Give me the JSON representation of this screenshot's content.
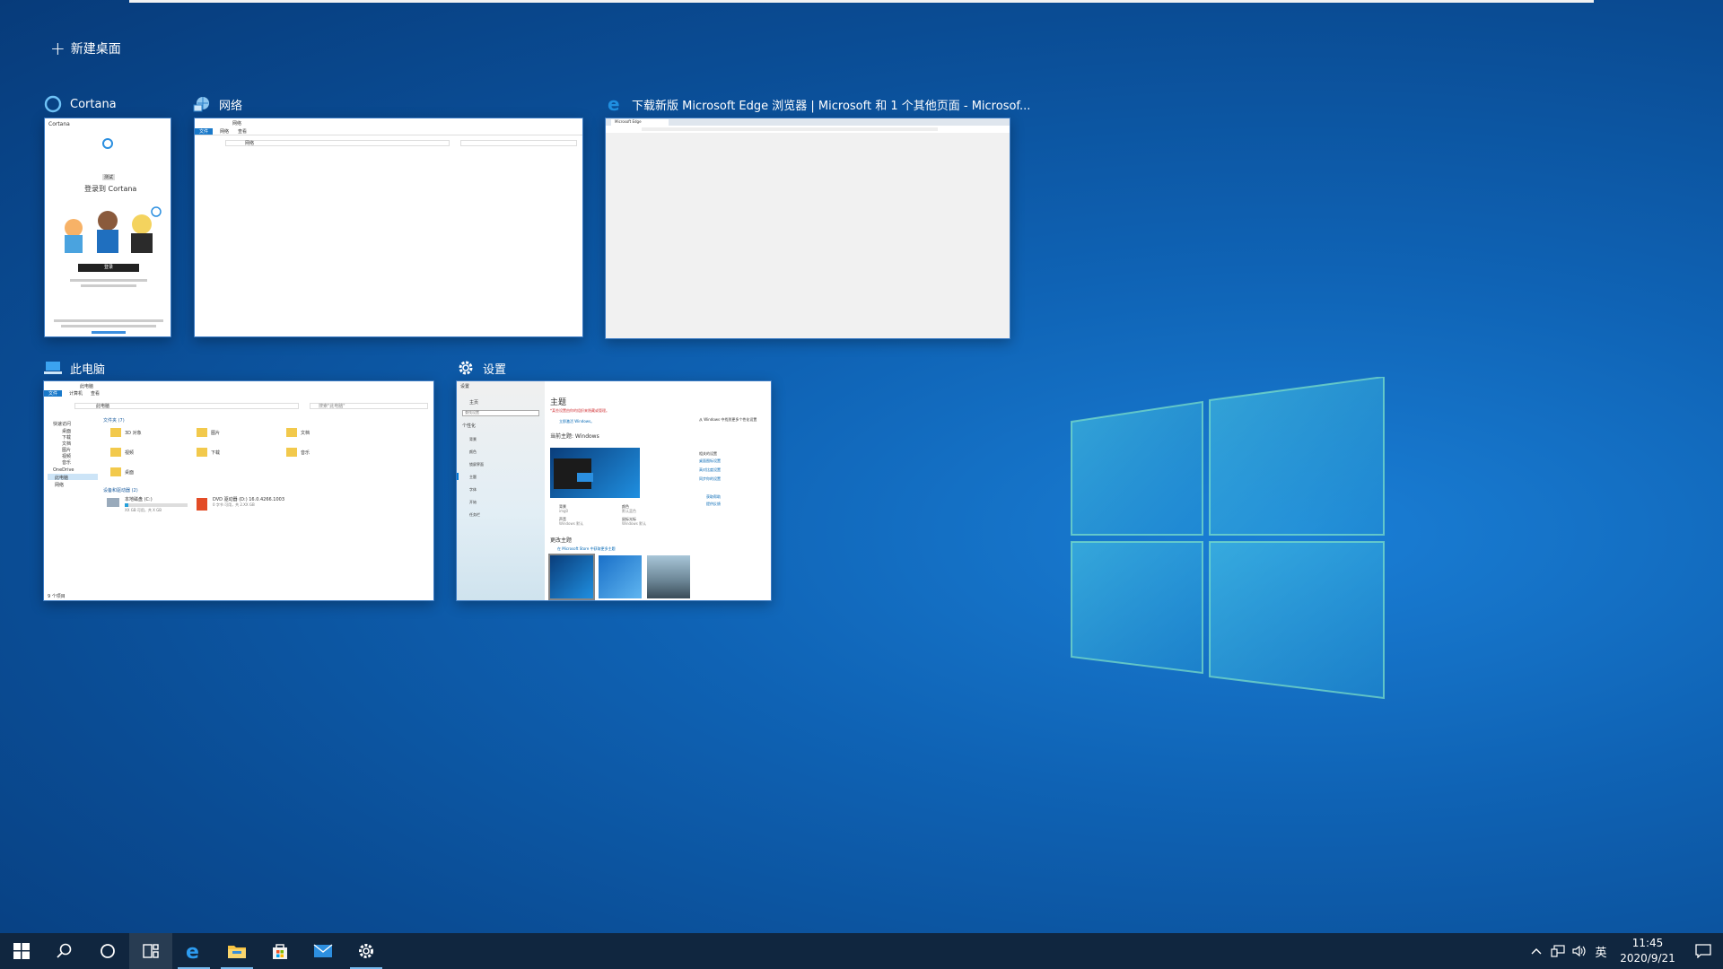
{
  "new_desktop_label": "新建桌面",
  "windows": [
    {
      "title": "Cortana",
      "icon": "cortana-ring-icon",
      "content": {
        "app_name": "Cortana",
        "badge": "测试",
        "signin_title": "登录到 Cortana",
        "signin_button": "登录"
      }
    },
    {
      "title": "网络",
      "icon": "network-icon",
      "content": {
        "window_title": "网络",
        "tabs": [
          "文件",
          "网络",
          "查看"
        ],
        "address": "网络"
      }
    },
    {
      "title": "下载新版 Microsoft Edge 浏览器 | Microsoft 和 1 个其他页面 - Microsof...",
      "icon": "edge-icon",
      "content": {
        "tab_title": "Microsoft Edge"
      }
    },
    {
      "title": "此电脑",
      "icon": "this-pc-icon",
      "content": {
        "window_title": "此电脑",
        "tabs": [
          "文件",
          "计算机",
          "查看"
        ],
        "address": "此电脑",
        "search_placeholder": "搜索\"此电脑\"",
        "nav": [
          "快速访问",
          "桌面",
          "下载",
          "文档",
          "图片",
          "视频",
          "音乐",
          "OneDrive",
          "此电脑",
          "网络"
        ],
        "folders_header": "文件夹 (7)",
        "folders": [
          "3D 对象",
          "视频",
          "图片",
          "文档",
          "下载",
          "音乐",
          "桌面"
        ],
        "devices_header": "设备和驱动器 (2)",
        "drives": [
          {
            "name": "本地磁盘 (C:)",
            "detail": "XX GB 可用，共 X GB"
          },
          {
            "name": "DVD 驱动器 (D:) 16.0.4266.1003",
            "detail": "0 字节 可用，共 2.XX GB"
          }
        ],
        "status": "9 个项目"
      }
    },
    {
      "title": "设置",
      "icon": "gear-icon",
      "content": {
        "app_name": "设置",
        "home": "主页",
        "search_placeholder": "查找设置",
        "section": "个性化",
        "nav": [
          "背景",
          "颜色",
          "锁屏界面",
          "主题",
          "字体",
          "开始",
          "任务栏"
        ],
        "page_title": "主题",
        "warning": "*某些设置由你的组织来隐藏或管理。",
        "sync_link": "立即激活 Windows。",
        "current_theme": "当前主题: Windows",
        "options": [
          {
            "label": "背景",
            "value": "img0"
          },
          {
            "label": "颜色",
            "value": "默认蓝色"
          },
          {
            "label": "声音",
            "value": "Windows 默认"
          },
          {
            "label": "鼠标光标",
            "value": "Windows 默认"
          }
        ],
        "side_note": "从 Windows 中找到更多个性化设置",
        "related_title": "相关的设置",
        "related_links": [
          "桌面图标设置",
          "高对比度设置",
          "同步你的设置"
        ],
        "help_links": [
          "获取帮助",
          "提供反馈"
        ],
        "change_theme": "更改主题",
        "store_link": "在 Microsoft Store 中获取更多主题"
      }
    }
  ],
  "taskbar": {
    "buttons": [
      {
        "name": "start-button",
        "icon": "windows-logo-icon"
      },
      {
        "name": "search-button",
        "icon": "search-icon"
      },
      {
        "name": "cortana-button",
        "icon": "cortana-ring-icon"
      },
      {
        "name": "task-view-button",
        "icon": "task-view-icon",
        "active": true
      },
      {
        "name": "edge-button",
        "icon": "edge-icon",
        "running": true
      },
      {
        "name": "file-explorer-button",
        "icon": "folder-icon",
        "running": true
      },
      {
        "name": "store-button",
        "icon": "store-icon"
      },
      {
        "name": "mail-button",
        "icon": "mail-icon"
      },
      {
        "name": "settings-button",
        "icon": "gear-icon",
        "running": true
      }
    ],
    "ime": "英",
    "time": "11:45",
    "date": "2020/9/21"
  },
  "colors": {
    "accent": "#76b9ed",
    "taskbar": "#10263f",
    "desktop": "#0f63b5"
  }
}
